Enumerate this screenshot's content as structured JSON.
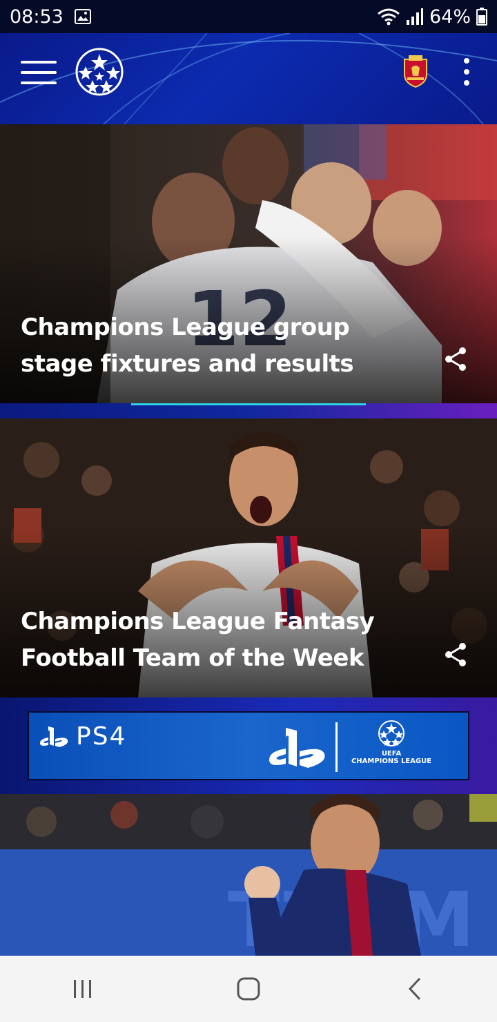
{
  "status_bar": {
    "time": "08:53",
    "battery": "64%",
    "icons": [
      "image-icon",
      "wifi-icon",
      "signal-icon",
      "battery-icon"
    ]
  },
  "header": {
    "menu_icon": "hamburger-icon",
    "logo": "champions-league-starball-logo",
    "club_crest": "liverpool-crest",
    "more_icon": "more-vertical-icon"
  },
  "cards": [
    {
      "title": "Champions League group stage fixtures and results",
      "share_icon": "share-icon"
    },
    {
      "title": "Champions League Fantasy Football Team of the Week",
      "share_icon": "share-icon"
    },
    {
      "title": "",
      "share_icon": ""
    }
  ],
  "ad": {
    "ps4_text": "PS4",
    "ucl_text": "CHAMPIONS LEAGUE",
    "uefa_text": "UEFA"
  },
  "nav": {
    "buttons": [
      "recent-apps-icon",
      "home-icon",
      "back-icon"
    ]
  },
  "colors": {
    "header_blue": "#0c2bb0",
    "accent_cyan": "#2fd3e6",
    "ad_blue": "#1a66cc"
  }
}
